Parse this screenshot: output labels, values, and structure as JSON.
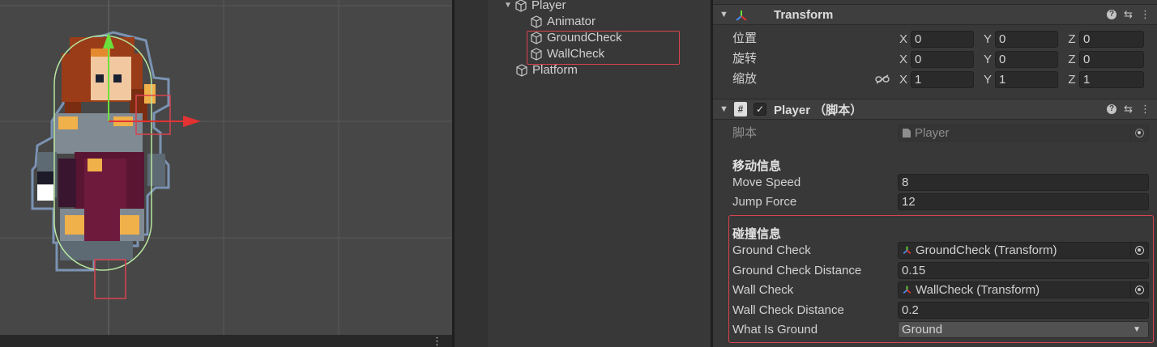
{
  "scene": {
    "menu_dots": "⋮"
  },
  "hierarchy": {
    "items": [
      {
        "label": "Player",
        "expanded": true
      },
      {
        "label": "Animator"
      },
      {
        "label": "GroundCheck"
      },
      {
        "label": "WallCheck"
      },
      {
        "label": "Platform"
      }
    ],
    "highlight_color": "#d9434f"
  },
  "inspector": {
    "transform": {
      "title": "Transform",
      "fold": "▼",
      "rows": [
        {
          "label": "位置",
          "x": "0",
          "y": "0",
          "z": "0"
        },
        {
          "label": "旋转",
          "x": "0",
          "y": "0",
          "z": "0"
        },
        {
          "label": "缩放",
          "x": "1",
          "y": "1",
          "z": "1"
        }
      ],
      "axis_x": "X",
      "axis_y": "Y",
      "axis_z": "Z"
    },
    "player": {
      "title": "Player （脚本）",
      "fold": "▼",
      "enabled_mark": "✓",
      "script_icon": "#",
      "script_label": "脚本",
      "script_value": "Player",
      "section_move": "移动信息",
      "move_speed_label": "Move Speed",
      "move_speed": "8",
      "jump_force_label": "Jump Force",
      "jump_force": "12",
      "section_collision": "碰撞信息",
      "ground_check_label": "Ground Check",
      "ground_check": "GroundCheck (Transform)",
      "ground_check_distance_label": "Ground Check Distance",
      "ground_check_distance": "0.15",
      "wall_check_label": "Wall Check",
      "wall_check": "WallCheck (Transform)",
      "wall_check_distance_label": "Wall Check Distance",
      "wall_check_distance": "0.2",
      "what_is_ground_label": "What Is Ground",
      "what_is_ground": "Ground"
    },
    "tool_help": "?",
    "tool_presets": "⇆",
    "tool_more": "⋮",
    "dropdown_caret": "▼"
  }
}
